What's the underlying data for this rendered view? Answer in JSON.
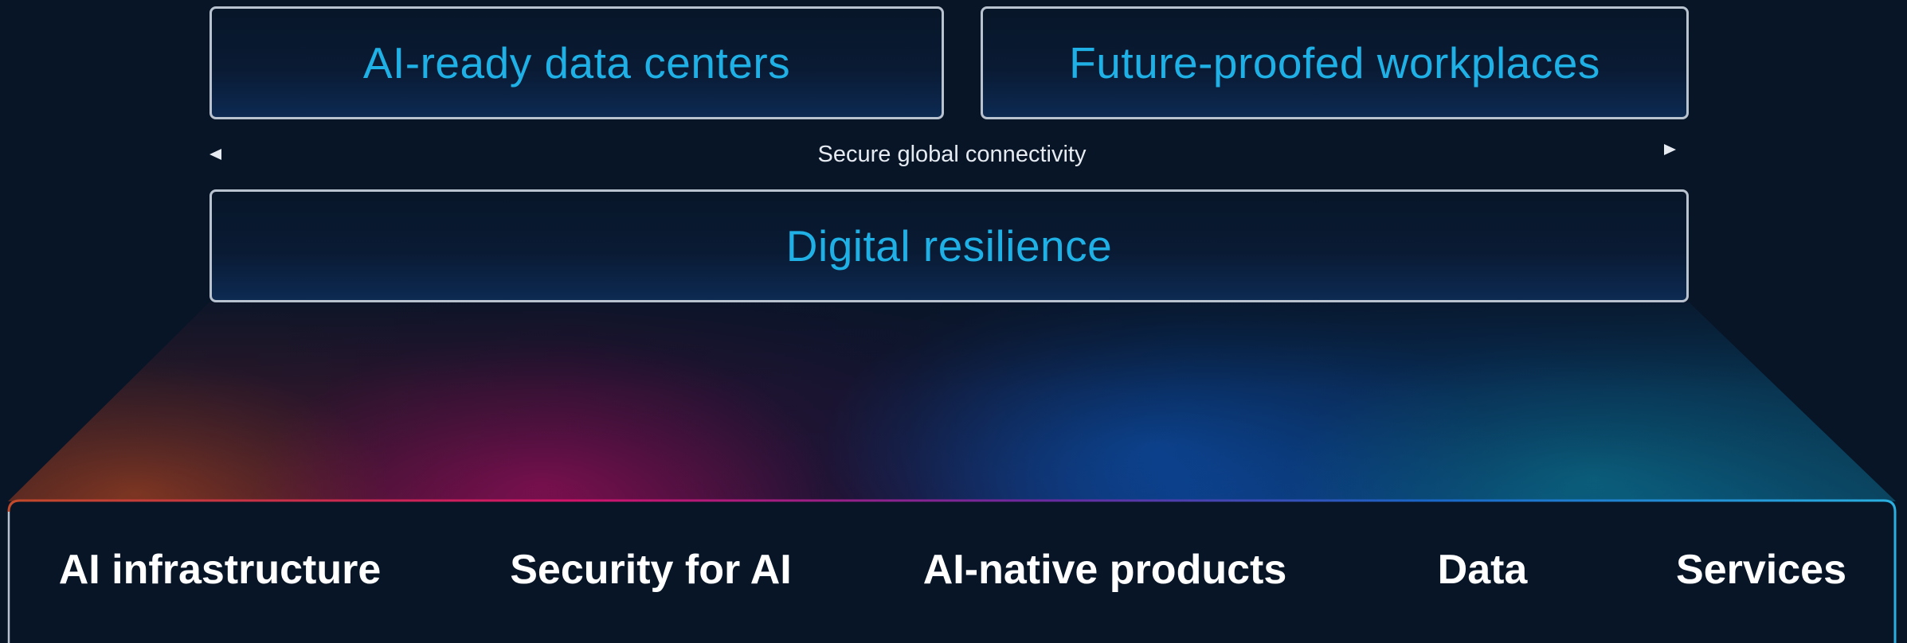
{
  "outcomes": {
    "top_left": "AI-ready data centers",
    "top_right": "Future-proofed workplaces",
    "foundation": "Digital resilience"
  },
  "connectivity": {
    "label": "Secure global connectivity"
  },
  "pillars": [
    "AI infrastructure",
    "Security for AI",
    "AI-native products",
    "Data",
    "Services"
  ],
  "colors": {
    "background": "#071527",
    "box_border": "#b9c2cf",
    "outcome_text": "#1fb1e6",
    "pillar_text": "#ffffff",
    "glow_orange": "#8a3a1f",
    "glow_magenta": "#7a0f4a",
    "glow_blue": "#0a4a9a",
    "glow_teal": "#0b6a80"
  }
}
